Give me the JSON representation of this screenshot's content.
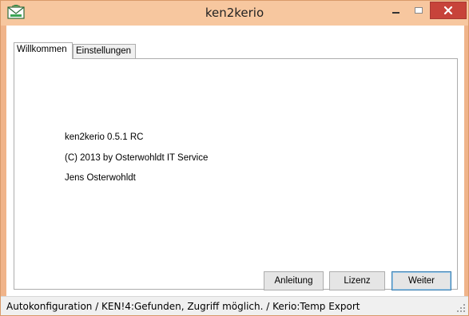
{
  "window": {
    "title": "ken2kerio",
    "icon": "envelope-icon"
  },
  "tabs": [
    {
      "label": "Willkommen",
      "active": true
    },
    {
      "label": "Einstellungen",
      "active": false
    }
  ],
  "welcome": {
    "lines": [
      "ken2kerio 0.5.1 RC",
      "(C) 2013 by Osterwohldt IT Service",
      "Jens Osterwohldt"
    ]
  },
  "buttons": {
    "anleitung": "Anleitung",
    "lizenz": "Lizenz",
    "weiter": "Weiter"
  },
  "statusbar": {
    "text": "Autokonfiguration / KEN!4:Gefunden, Zugriff möglich. / Kerio:Temp Export"
  },
  "colors": {
    "titlebar": "#f7c79f",
    "close_button": "#c7433a",
    "default_button_border": "#3c7fb1"
  }
}
